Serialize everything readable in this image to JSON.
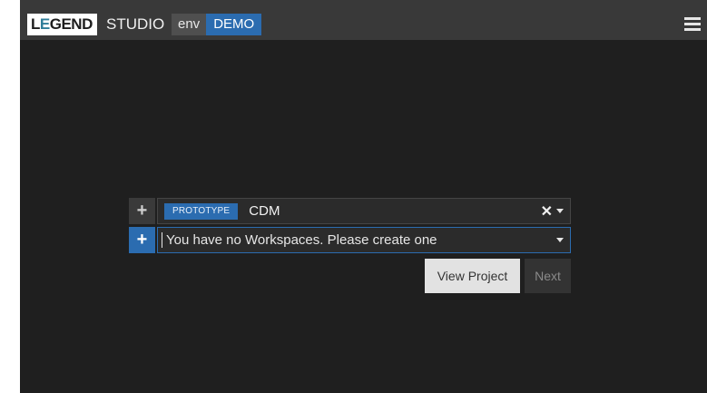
{
  "header": {
    "logo_text": "LEGEND",
    "logo_prefix": "L",
    "logo_accent": "E",
    "logo_rest": "GEND",
    "studio_label": "STUDIO",
    "env_label": "env",
    "env_value": "DEMO",
    "menu_icon": "hamburger-menu-icon"
  },
  "setup": {
    "project_row": {
      "add_icon": "plus-icon",
      "tag": "PROTOTYPE",
      "project_name": "CDM",
      "clear_icon": "close-icon",
      "dropdown_icon": "chevron-down-icon"
    },
    "workspace_row": {
      "add_icon": "plus-icon",
      "placeholder": "You have no Workspaces. Please create one",
      "dropdown_icon": "chevron-down-icon"
    },
    "buttons": {
      "view_project": "View Project",
      "next": "Next"
    }
  },
  "colors": {
    "header_bg": "#393939",
    "main_bg": "#1f1f1f",
    "accent_blue": "#2b6cb0"
  }
}
